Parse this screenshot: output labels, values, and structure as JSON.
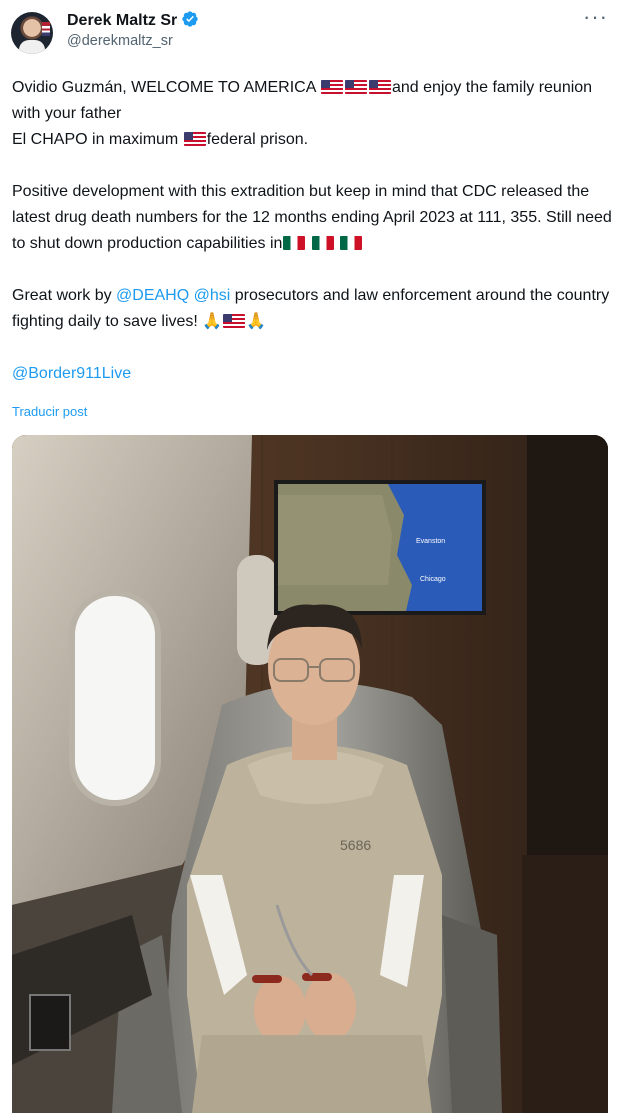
{
  "author": {
    "name": "Derek Maltz Sr",
    "handle": "@derekmaltz_sr",
    "verified": true
  },
  "tweet": {
    "line1_a": "Ovidio Guzmán, WELCOME TO AMERICA ",
    "line1_b": "and enjoy the family reunion with your father",
    "line2_a": "El CHAPO in maximum ",
    "line2_b": "federal prison.",
    "para2": "Positive development with this extradition but keep in mind that CDC released the latest drug death numbers for the 12 months ending April 2023 at 111, 355. Still need to shut down production capabilities in",
    "para3_a": "Great work by ",
    "mention_dea": "@DEAHQ",
    "mention_hsi": "@hsi",
    "para3_b": " prosecutors and law enforcement around the country fighting daily to save lives! ",
    "mention_border": "@Border911Live"
  },
  "translate_label": "Traducir post",
  "photo": {
    "screen_map_labels": [
      "Evanston",
      "Chicago"
    ],
    "badge_text": "5686"
  },
  "icons": [
    "verified-badge-icon",
    "more-options-icon",
    "us-flag-icon",
    "mexico-flag-icon",
    "praying-hands-icon"
  ],
  "colors": {
    "link": "#1d9bf0",
    "text": "#0f1419",
    "secondary": "#536471",
    "verified": "#1d9bf0"
  }
}
